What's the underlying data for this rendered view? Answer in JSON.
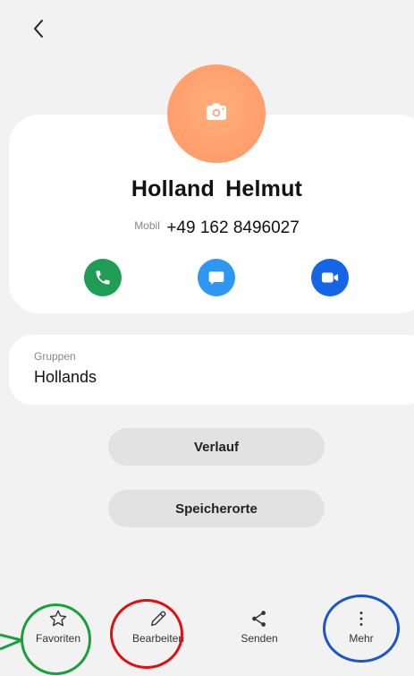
{
  "header": {
    "back_icon": "chevron-left-icon"
  },
  "contact": {
    "name": "Holland  Helmut",
    "avatar_icon": "camera-icon",
    "avatar_color": "#ffa36f",
    "phone_type": "Mobil",
    "phone_number": "+49 162 8496027"
  },
  "actions": [
    {
      "icon": "phone-icon",
      "color": "#1f9d55"
    },
    {
      "icon": "message-icon",
      "color": "#2e97f3"
    },
    {
      "icon": "video-icon",
      "color": "#1466e6"
    }
  ],
  "groups": {
    "label": "Gruppen",
    "value": "Hollands"
  },
  "buttons": {
    "history": "Verlauf",
    "storage": "Speicherorte"
  },
  "bottom_nav": {
    "favorites": "Favoriten",
    "edit": "Bearbeiten",
    "send": "Senden",
    "more": "Mehr"
  },
  "annotations": {
    "green_ring": "#1aa03a",
    "red_ring": "#e01010",
    "blue_ring": "#1a56c8"
  }
}
